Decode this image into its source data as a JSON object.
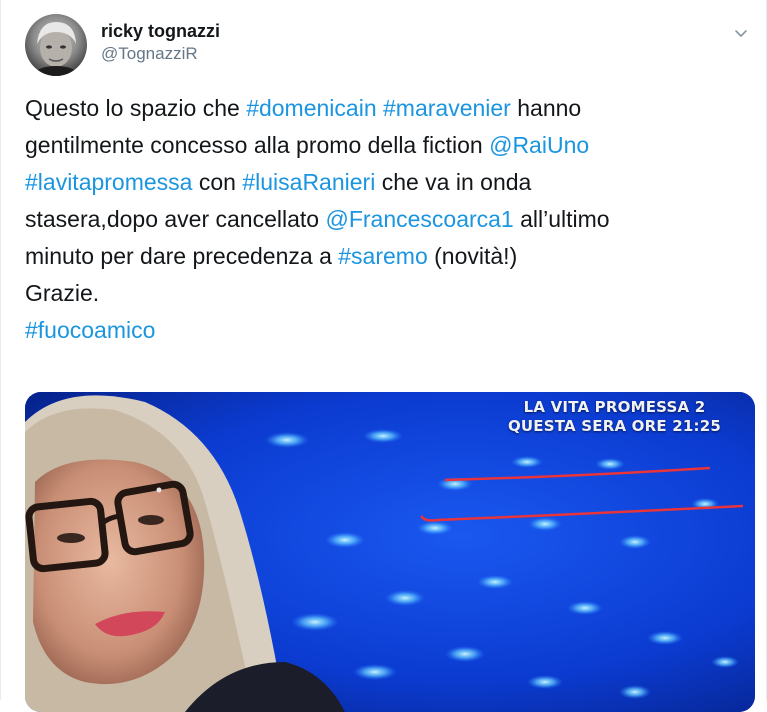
{
  "author": {
    "display_name": "ricky tognazzi",
    "handle": "@TognazziR"
  },
  "menu_icon": "chevron-down-icon",
  "tweet": {
    "lines": [
      [
        {
          "t": "Questo lo spazio che ",
          "link": false
        },
        {
          "t": "#domenicain",
          "link": true
        },
        {
          "t": " ",
          "link": false
        },
        {
          "t": "#maravenier",
          "link": true
        },
        {
          "t": " hanno",
          "link": false
        }
      ],
      [
        {
          "t": "gentilmente concesso alla promo della fiction ",
          "link": false
        },
        {
          "t": "@RaiUno",
          "link": true
        }
      ],
      [
        {
          "t": "#lavitapromessa",
          "link": true
        },
        {
          "t": " con ",
          "link": false
        },
        {
          "t": "#luisaRanieri",
          "link": true
        },
        {
          "t": " che va in onda",
          "link": false
        }
      ],
      [
        {
          "t": "stasera,dopo aver cancellato ",
          "link": false
        },
        {
          "t": "@Francescoarca1",
          "link": true
        },
        {
          "t": " all’ultimo",
          "link": false
        }
      ],
      [
        {
          "t": "minuto per dare precedenza a ",
          "link": false
        },
        {
          "t": "#saremo",
          "link": true
        },
        {
          "t": " (novità!)",
          "link": false
        }
      ],
      [
        {
          "t": "Grazie.",
          "link": false
        }
      ],
      [
        {
          "t": "#fuocoamico",
          "link": true
        }
      ]
    ]
  },
  "media": {
    "overlay_line1": "LA VITA PROMESSA 2",
    "overlay_line2": "QUESTA SERA ORE 21:25"
  },
  "colors": {
    "link": "#1b95e0",
    "text": "#14171a",
    "secondary": "#657786",
    "media_blue": "#0a36c8",
    "annotation_red": "#e8343a"
  }
}
